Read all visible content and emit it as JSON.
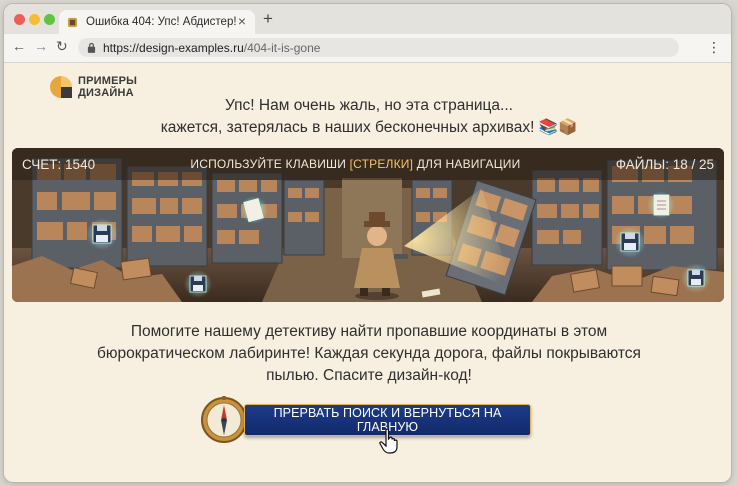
{
  "browser": {
    "tab_title": "Ошибка 404: Упс! Абдистер!",
    "tab_close": "×",
    "new_tab": "+",
    "url_domain": "https://design-examples.ru",
    "url_path": "/404-it-is-gone",
    "menu_glyph": "⋮",
    "back_glyph": "←",
    "forward_glyph": "→",
    "reload_glyph": "↻"
  },
  "logo": {
    "line1": "ПРИМЕРЫ",
    "line2": "ДИЗАЙНА"
  },
  "headline": {
    "line1": "Упс! Нам очень жаль, но эта страница...",
    "line2": "кажется, затерялась в наших бесконечных архивах! 📚📦"
  },
  "hud": {
    "score": "СЧЕТ: 1540",
    "hint_before": "ИСПОЛЬЗУЙТЕ КЛАВИШИ ",
    "hint_key": "[СТРЕЛКИ]",
    "hint_after": " ДЛЯ НАВИГАЦИИ",
    "files": "ФАЙЛЫ: 18 / 25"
  },
  "instruction": "Помогите нашему детективу найти пропавшие координаты в этом бюрократическом лабиринте! Каждая секунда дорога, файлы покрываются пылью. Спасите дизайн-код!",
  "cta": {
    "label": "ПРЕРВАТЬ ПОИСК И ВЕРНУТЬСЯ НА ГЛАВНУЮ"
  },
  "icons": [
    "compass-icon",
    "floppy-disk-icon",
    "document-icon",
    "pointer-hand-icon",
    "lock-icon"
  ],
  "colors": {
    "page_bg": "#f7efdf",
    "button_bg": "#1d3b8a",
    "button_border": "#e0b550",
    "hud_accent": "#f5c36a"
  }
}
